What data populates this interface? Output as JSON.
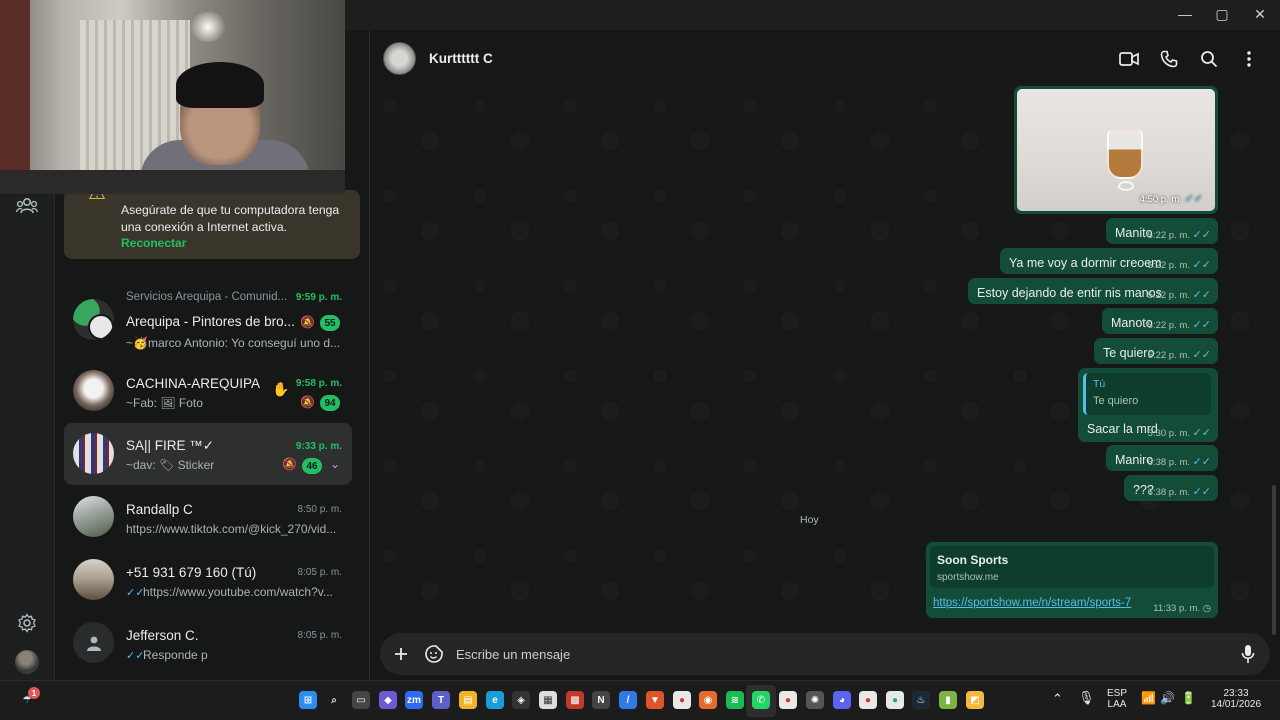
{
  "window": {
    "minimize_glyph": "—",
    "maximize_glyph": "▢",
    "close_glyph": "✕"
  },
  "rail": {
    "icons": [
      "communities-icon",
      "settings-icon",
      "profile-avatar"
    ]
  },
  "banner": {
    "text": "Asegúrate de que tu computadora tenga una conexión a Internet activa.",
    "link": "Reconectar"
  },
  "chats": [
    {
      "group": "Servicios Arequipa - Comunid...",
      "name": "Arequipa - Pintores de bro...",
      "time": "9:59 p. m.",
      "last": "~🥳marco Antonio: Yo conseguí uno d...",
      "unread": "55",
      "muted": true
    },
    {
      "name": "CACHINA-AREQUIPA",
      "time": "9:58 p. m.",
      "last": "~Fab: 🖼 Foto",
      "unread": "94",
      "muted": true
    },
    {
      "name": "SA|| FIRE ™✓",
      "time": "9:33 p. m.",
      "last": "~dav: 🏷 Sticker",
      "unread": "46",
      "muted": true
    },
    {
      "name": "Randallp C",
      "time": "8:50 p. m.",
      "last": "https://www.tiktok.com/@kick_270/vid..."
    },
    {
      "name": "+51 931 679 160 (Tú)",
      "time": "8:05 p. m.",
      "last": "https://www.youtube.com/watch?v..."
    },
    {
      "name": "Jefferson C.",
      "time": "8:05 p. m.",
      "last": "Responde p"
    }
  ],
  "conversation": {
    "contact_name": "Kurtttttt C",
    "image_time": "4:50 p. m.",
    "messages": [
      {
        "text": "Manito",
        "time": "5:22 p. m."
      },
      {
        "text": "Ya me voy a dormir creoem",
        "time": "5:22 p. m."
      },
      {
        "text": "Estoy dejando de entir nis manos",
        "time": "5:22 p. m."
      },
      {
        "text": "Manoto",
        "time": "5:22 p. m."
      },
      {
        "text": "Te quiero",
        "time": "5:22 p. m."
      }
    ],
    "reply": {
      "quoted_author": "Tú",
      "quoted_text": "Te quiero",
      "text": "Sacar la mrd",
      "time": "5:30 p. m."
    },
    "messages_after": [
      {
        "text": "Maniro",
        "time": "6:38 p. m."
      },
      {
        "text": "???",
        "time": "6:38 p. m."
      }
    ],
    "date_separator": "Hoy",
    "link_message": {
      "title": "Soon Sports",
      "domain": "sportshow.me",
      "url": "https://sportshow.me/n/stream/sports-7",
      "time": "11:33 p. m."
    },
    "composer_placeholder": "Escribe un mensaje",
    "read_ticks": "✓✓"
  },
  "taskbar": {
    "lang_top": "ESP",
    "lang_bottom": "LAA",
    "time": "23:33",
    "date": "14/01/2026",
    "notification_count": "1"
  },
  "colors": {
    "accent_green": "#21c063",
    "outgoing_bubble": "#144d37",
    "read_tick": "#53bdeb",
    "background": "#161717"
  }
}
